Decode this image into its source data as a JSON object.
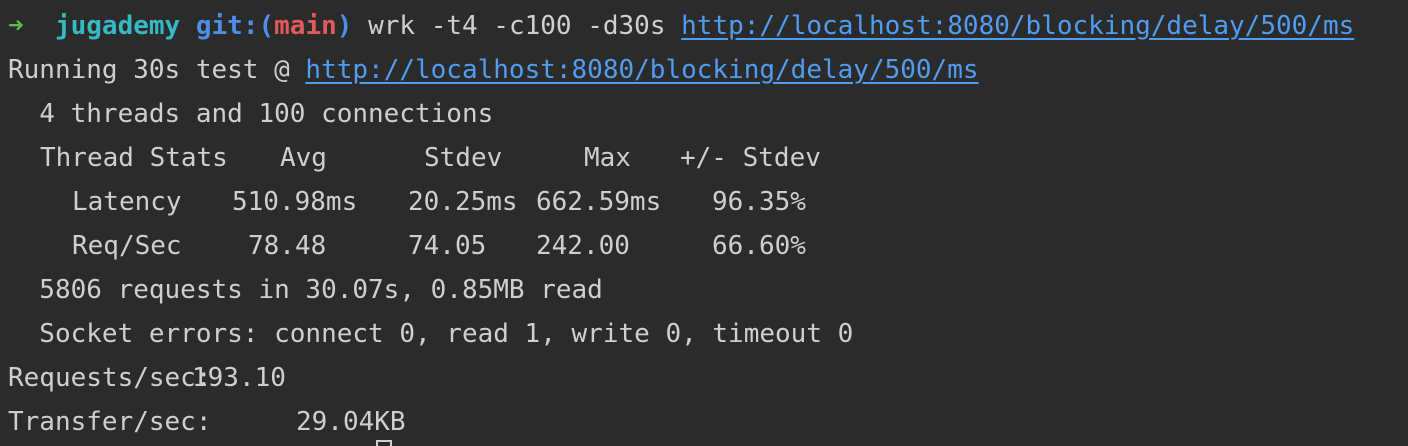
{
  "prompt": {
    "arrow": "➜",
    "repo": "jugademy",
    "git_prefix": "git:(",
    "branch": "main",
    "git_suffix": ")",
    "command": "wrk -t4 -c100 -d30s",
    "url": "http://localhost:8080/blocking/delay/500/ms"
  },
  "output": {
    "running_prefix": "Running 30s test @ ",
    "running_url": "http://localhost:8080/blocking/delay/500/ms",
    "threads_line": "  4 threads and 100 connections",
    "stats_header": [
      "Thread Stats",
      "Avg",
      "Stdev",
      "Max",
      "+/- Stdev"
    ],
    "stats_rows": [
      {
        "name": "Latency",
        "avg": "510.98ms",
        "stdev": "20.25ms",
        "max": "662.59ms",
        "pct": "96.35%"
      },
      {
        "name": "Req/Sec",
        "avg": "78.48",
        "stdev": "74.05",
        "max": "242.00",
        "pct": "66.60%"
      }
    ],
    "requests_line": "  5806 requests in 30.07s, 0.85MB read",
    "socket_errors_line": "  Socket errors: connect 0, read 1, write 0, timeout 0",
    "requests_sec_label": "Requests/sec:",
    "requests_sec_value": "193.10",
    "transfer_sec_label": "Transfer/sec:",
    "transfer_sec_value": "29.04KB"
  },
  "colors": {
    "background": "#2b2b2b",
    "text": "#cfcfcf",
    "arrow": "#5fba47",
    "repo": "#35b9c4",
    "git": "#4d8ee8",
    "branch": "#e05a5a",
    "link": "#4f9cf0"
  }
}
